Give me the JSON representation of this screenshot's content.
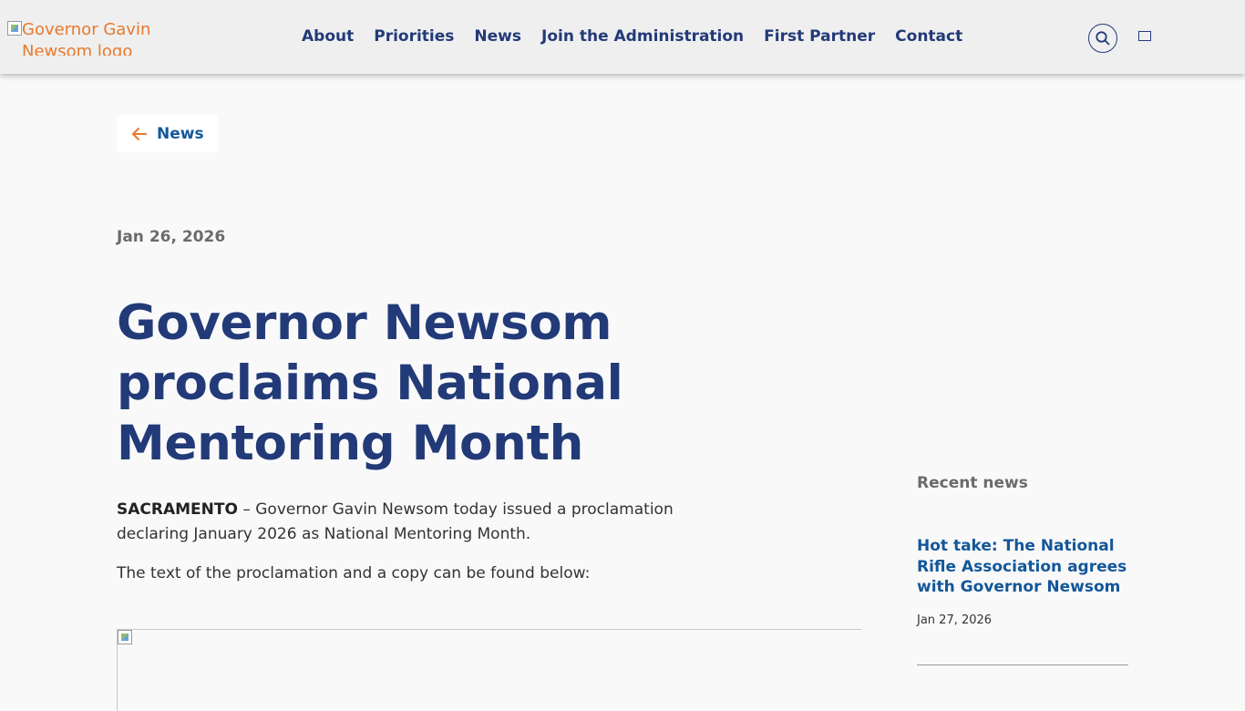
{
  "header": {
    "logo_alt": "Governor Gavin Newsom logo",
    "nav": [
      {
        "label": "About"
      },
      {
        "label": "Priorities"
      },
      {
        "label": "News"
      },
      {
        "label": "Join the Administration"
      },
      {
        "label": "First Partner"
      },
      {
        "label": "Contact"
      }
    ],
    "search_icon": "search-icon",
    "menu_icon": "menu-icon"
  },
  "back_link": {
    "label": "News",
    "icon": "arrow-left-icon"
  },
  "article": {
    "date": "Jan 26, 2026",
    "title": "Governor Newsom proclaims National Mentoring Month",
    "dateline": "SACRAMENTO",
    "lead": " – Governor Gavin Newsom today issued a proclamation declaring January 2026 as National Mentoring Month.",
    "paragraph_2": "The text of the proclamation and a copy can be found below:"
  },
  "sidebar": {
    "heading": "Recent news",
    "items": [
      {
        "title": "Hot take: The National Rifle Association agrees with Governor Newsom",
        "date": "Jan 27, 2026"
      }
    ]
  },
  "colors": {
    "nav_text": "#223a78",
    "link_blue": "#13579a",
    "accent_orange": "#e8792c",
    "header_bg": "#efefef",
    "page_bg": "#f9f9f9"
  }
}
